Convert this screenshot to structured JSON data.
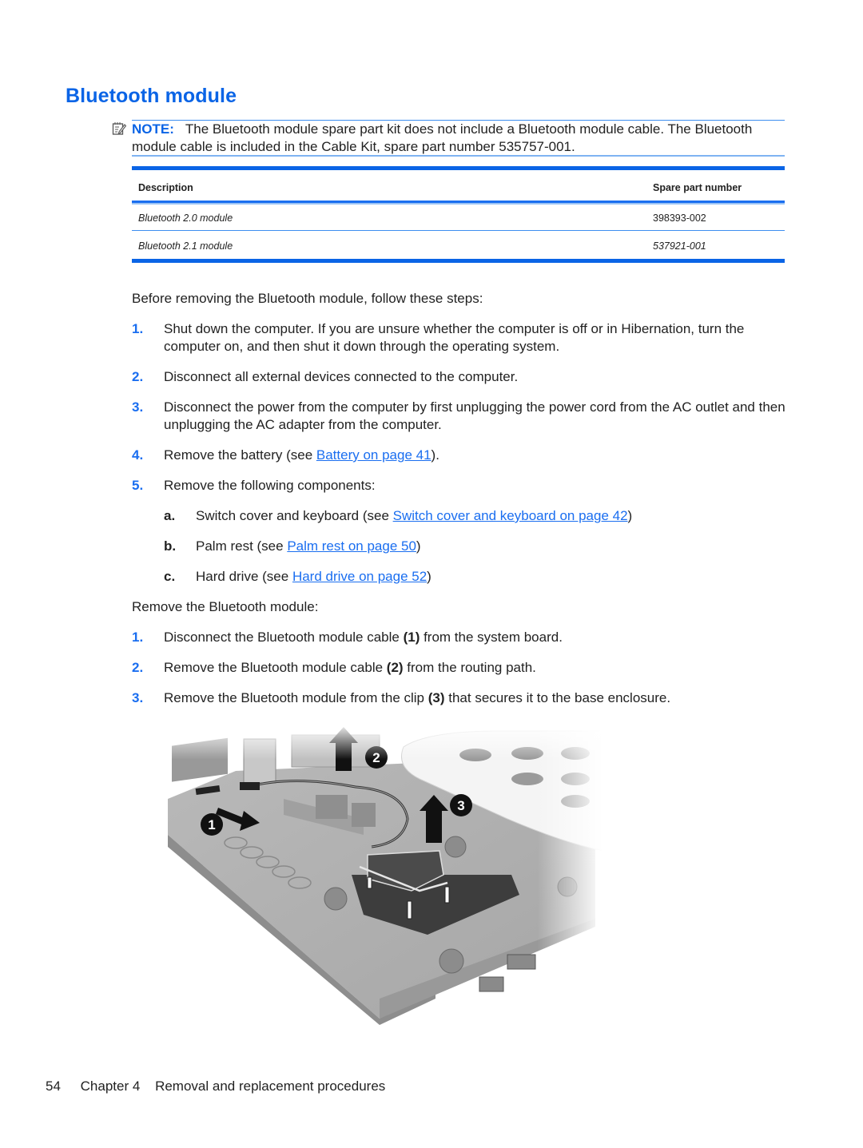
{
  "section": {
    "title": "Bluetooth module"
  },
  "note": {
    "icon": "note-pencil-icon",
    "label": "NOTE:",
    "text": "The Bluetooth module spare part kit does not include a Bluetooth module cable. The Bluetooth module cable is included in the Cable Kit, spare part number 535757-001."
  },
  "table": {
    "headers": [
      "Description",
      "Spare part number"
    ],
    "rows": [
      {
        "description": "Bluetooth 2.0 module",
        "part_number": "398393-002"
      },
      {
        "description": "Bluetooth 2.1 module",
        "part_number": "537921-001"
      }
    ]
  },
  "before": {
    "intro": "Before removing the Bluetooth module, follow these steps:",
    "steps": [
      {
        "num": "1.",
        "text": "Shut down the computer. If you are unsure whether the computer is off or in Hibernation, turn the computer on, and then shut it down through the operating system."
      },
      {
        "num": "2.",
        "text": "Disconnect all external devices connected to the computer."
      },
      {
        "num": "3.",
        "text": "Disconnect the power from the computer by first unplugging the power cord from the AC outlet and then unplugging the AC adapter from the computer."
      },
      {
        "num": "4.",
        "prefix": "Remove the battery (see ",
        "link": "Battery on page 41",
        "suffix": ")."
      },
      {
        "num": "5.",
        "text": "Remove the following components:"
      }
    ],
    "substeps": [
      {
        "letter": "a.",
        "prefix": "Switch cover and keyboard (see ",
        "link": "Switch cover and keyboard on page 42",
        "suffix": ")"
      },
      {
        "letter": "b.",
        "prefix": "Palm rest (see ",
        "link": "Palm rest on page 50",
        "suffix": ")"
      },
      {
        "letter": "c.",
        "prefix": "Hard drive (see ",
        "link": "Hard drive on page 52",
        "suffix": ")"
      }
    ]
  },
  "remove": {
    "intro": "Remove the Bluetooth module:",
    "steps": [
      {
        "num": "1.",
        "pre": "Disconnect the Bluetooth module cable ",
        "callout": "(1)",
        "post": " from the system board."
      },
      {
        "num": "2.",
        "pre": "Remove the Bluetooth module cable ",
        "callout": "(2)",
        "post": " from the routing path."
      },
      {
        "num": "3.",
        "pre": "Remove the Bluetooth module from the clip ",
        "callout": "(3)",
        "post": " that secures it to the base enclosure."
      }
    ]
  },
  "illustration": {
    "description": "Grayscale illustration of the laptop base enclosure showing the Bluetooth module with removal arrows",
    "callouts": [
      "1",
      "2",
      "3"
    ]
  },
  "footer": {
    "page": "54",
    "chapter": "Chapter 4",
    "title": "Removal and replacement procedures"
  },
  "colors": {
    "accent": "#0a64e6",
    "link": "#1a6ef0",
    "text": "#222222"
  }
}
